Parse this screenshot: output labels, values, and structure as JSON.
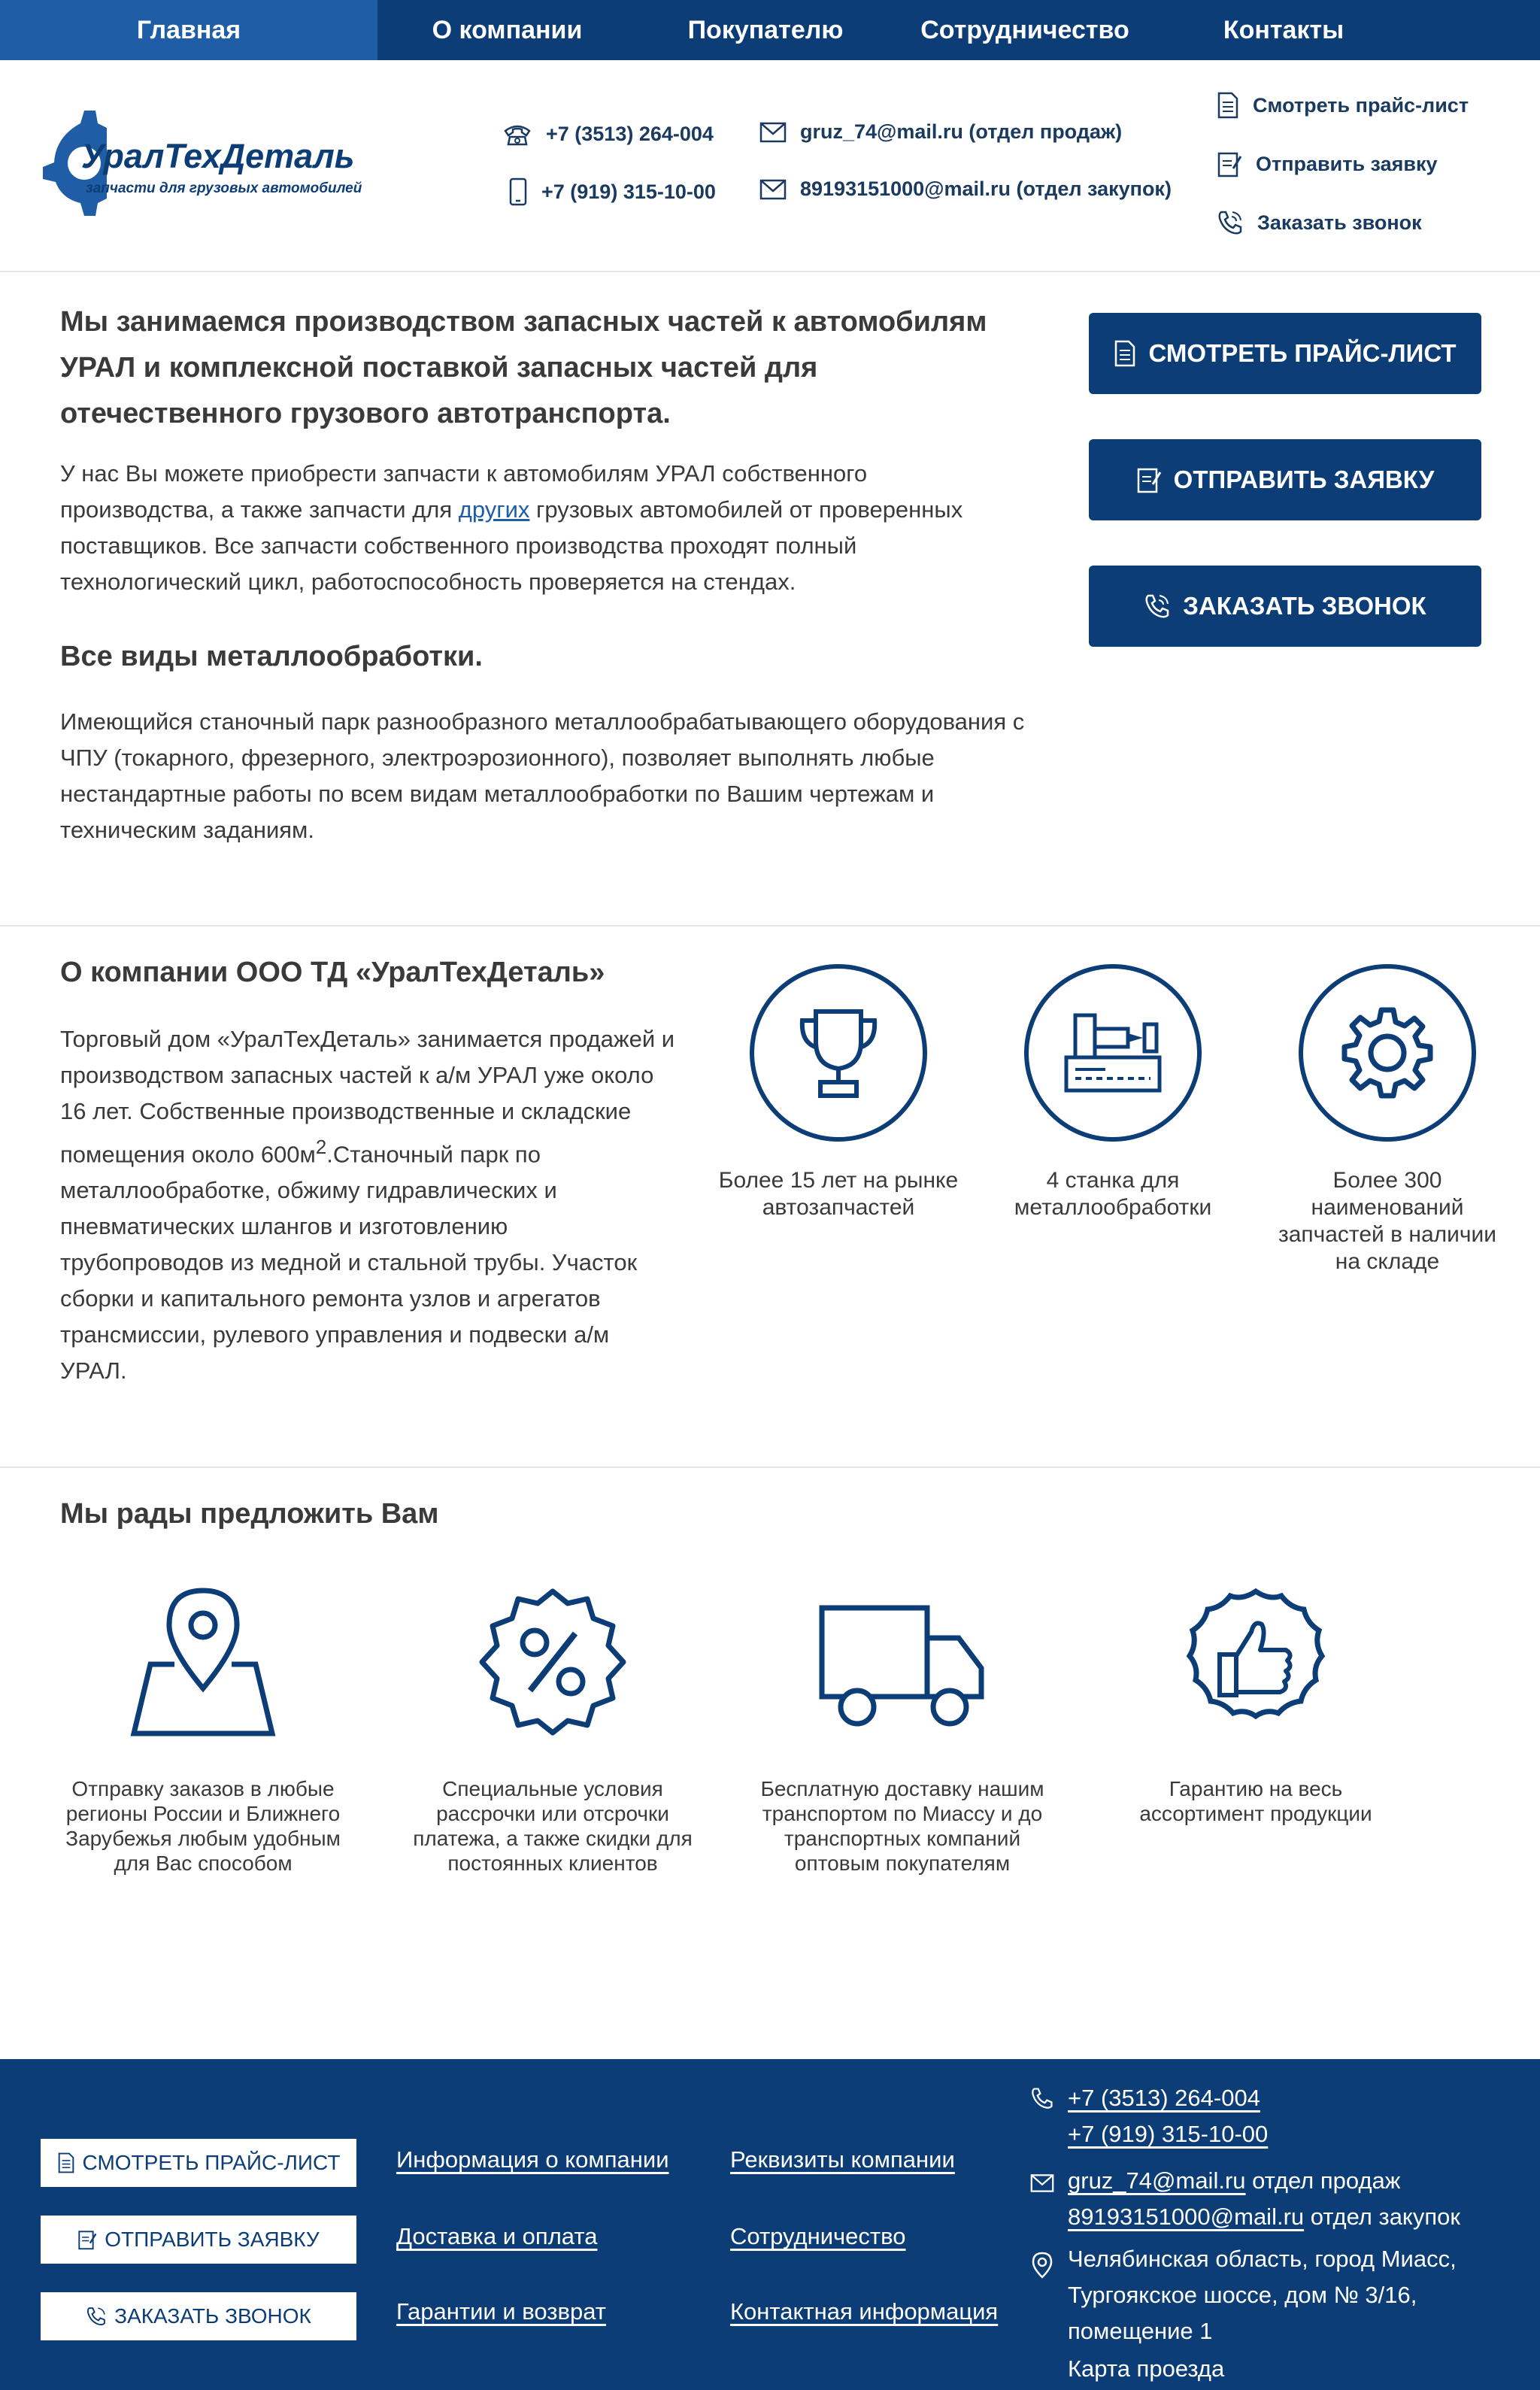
{
  "nav": {
    "items": [
      {
        "label": "Главная",
        "active": true
      },
      {
        "label": "О компании",
        "active": false
      },
      {
        "label": "Покупателю",
        "active": false
      },
      {
        "label": "Сотрудничество",
        "active": false
      },
      {
        "label": "Контакты",
        "active": false
      }
    ]
  },
  "header": {
    "logo_title": "УралТехДеталь",
    "logo_subtitle": "запчасти для грузовых автомобилей",
    "phone1": "+7 (3513) 264-004",
    "phone2": "+7 (919) 315-10-00",
    "email1": "gruz_74@mail.ru (отдел продаж)",
    "email2": "89193151000@mail.ru (отдел закупок)",
    "link_price": "Смотреть прайс-лист",
    "link_request": "Отправить заявку",
    "link_call": "Заказать звонок"
  },
  "hero": {
    "title": "Мы занимаемся производством запасных частей к автомобилям УРАЛ и комплексной поставкой запасных частей для отечественного грузового автотранспорта.",
    "p1_before": "У нас Вы можете приобрести запчасти к автомобилям УРАЛ собственного производства, а также запчасти для ",
    "p1_link": "других",
    "p1_after": " грузовых автомобилей от проверенных поставщиков. Все запчасти собственного производства проходят полный технологический цикл, работоспособность проверяется на стендах.",
    "h2": "Все виды металлообработки.",
    "p2": "Имеющийся станочный парк разнообразного металлообрабатывающего оборудования с ЧПУ (токарного, фрезерного, электроэрозионного), позволяет выполнять любые нестандартные работы по всем видам металлообработки по Вашим чертежам и техническим заданиям.",
    "btn_price": "СМОТРЕТЬ ПРАЙС-ЛИСТ",
    "btn_request": "ОТПРАВИТЬ ЗАЯВКУ",
    "btn_call": "ЗАКАЗАТЬ ЗВОНОК"
  },
  "about": {
    "title": "О компании ООО ТД «УралТехДеталь»",
    "text_before": "Торговый дом «УралТехДеталь» занимается продажей и производством запасных частей к а/м УРАЛ уже около 16 лет. Собственные производственные и складские помещения около 600м",
    "text_sup": "2",
    "text_after": ".Станочный парк по металлообработке, обжиму гидравлических и пневматических шлангов и изготовлению трубопроводов из медной и стальной трубы. Участок сборки и капитального ремонта узлов и агрегатов трансмиссии, рулевого управления и подвески а/м УРАЛ.",
    "features": [
      {
        "icon": "trophy-icon",
        "text": "Более 15 лет на рынке автозапчастей"
      },
      {
        "icon": "machine-icon",
        "text": "4 станка для металлообработки"
      },
      {
        "icon": "gear-icon",
        "text": "Более 300 наименований запчастей в наличии на складе"
      }
    ]
  },
  "offer": {
    "title": "Мы рады предложить Вам",
    "items": [
      {
        "icon": "map-pin-icon",
        "text": "Отправку заказов в любые регионы России и Ближнего Зарубежья любым удобным для Вас способом"
      },
      {
        "icon": "percent-badge-icon",
        "text": "Специальные условия рассрочки или отсрочки платежа, а также скидки для постоянных клиентов"
      },
      {
        "icon": "truck-icon",
        "text": "Бесплатную доставку нашим транспортом по Миассу и до транспортных компаний оптовым покупателям"
      },
      {
        "icon": "thumbs-up-icon",
        "text": "Гарантию на весь ассортимент продукции"
      }
    ]
  },
  "footer": {
    "btn_price": "СМОТРЕТЬ ПРАЙС-ЛИСТ",
    "btn_request": "ОТПРАВИТЬ ЗАЯВКУ",
    "btn_call": "ЗАКАЗАТЬ ЗВОНОК",
    "col1": [
      "Информация о компании",
      "Доставка и оплата",
      "Гарантии и возврат"
    ],
    "col2": [
      "Реквизиты компании",
      "Сотрудничество",
      "Контактная информация"
    ],
    "phone1": "+7 (3513) 264-004",
    "phone2": "+7 (919) 315-10-00",
    "email1": "gruz_74@mail.ru",
    "email1_note": " отдел продаж",
    "email2": "89193151000@mail.ru",
    "email2_note": " отдел закупок",
    "address": "Челябинская область, город Миасс, Тургоякское шоссе, дом № 3/16, помещение 1",
    "map_link": "Карта проезда"
  },
  "colors": {
    "brand": "#0c3d77",
    "nav_active": "#1f5ea6",
    "link": "#1f5ea6"
  }
}
